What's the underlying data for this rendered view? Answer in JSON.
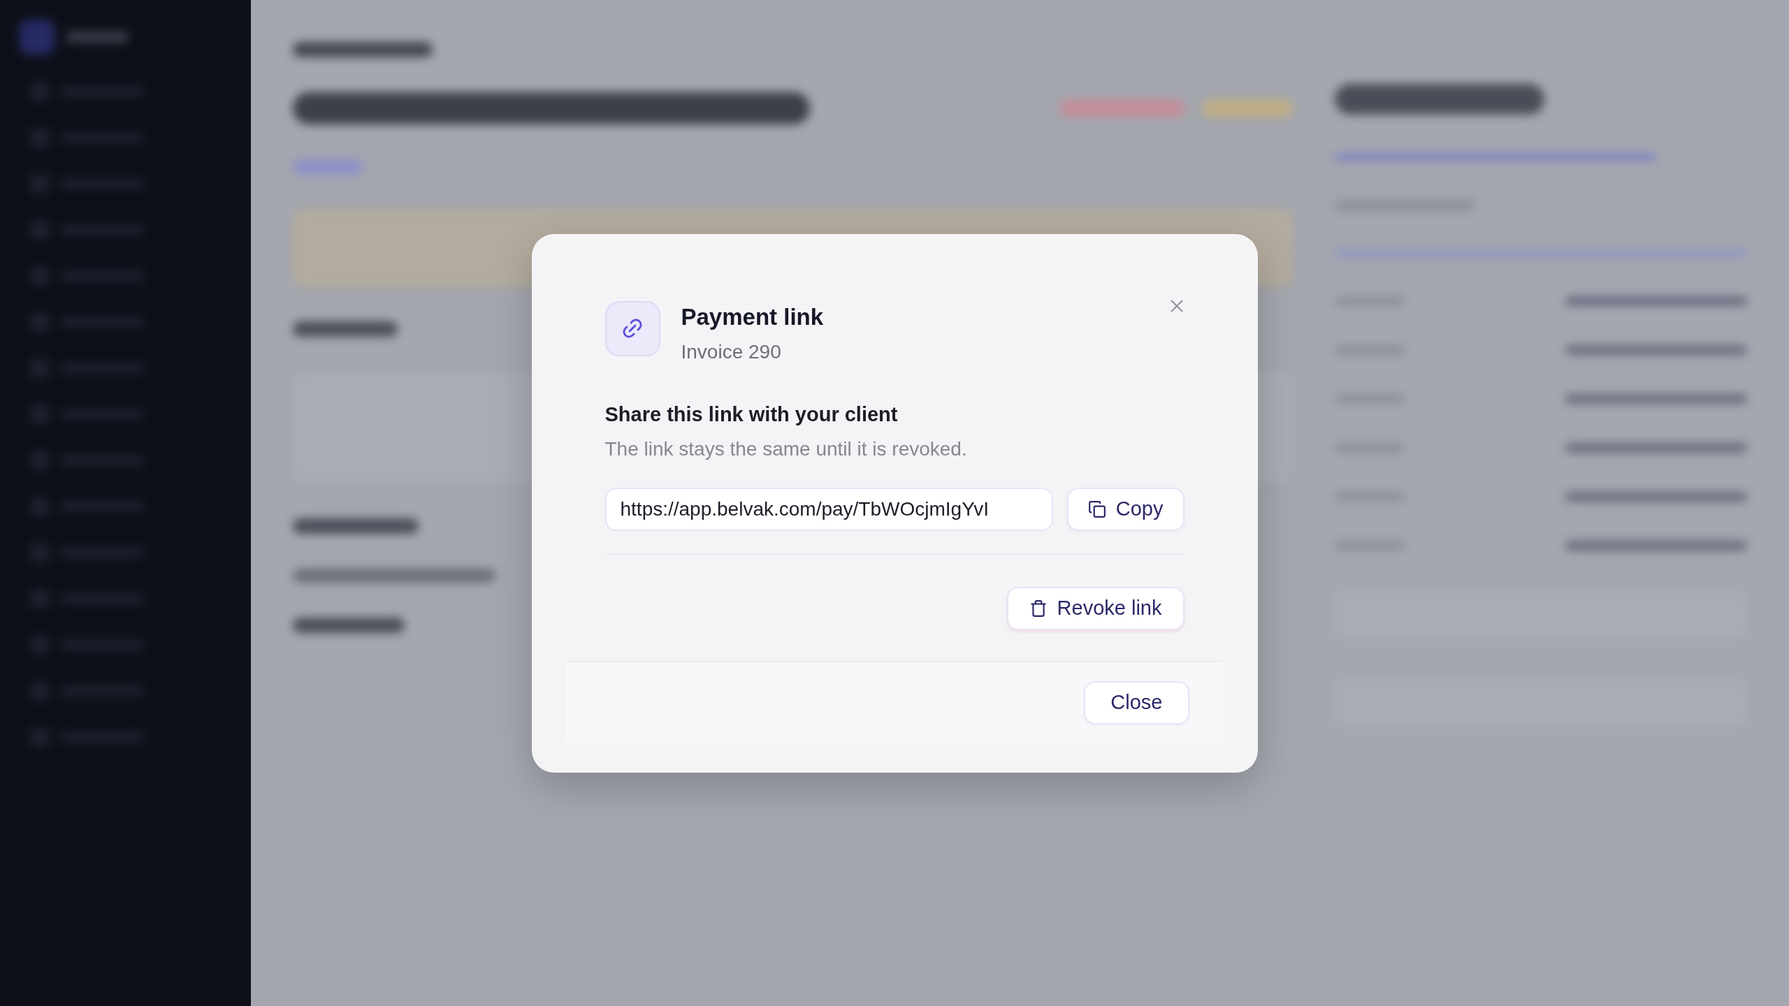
{
  "dialog": {
    "title": "Payment link",
    "subtitle": "Invoice 290",
    "section_title": "Share this link with your client",
    "section_hint": "The link stays the same until it is revoked.",
    "link_field": {
      "value": "https://app.belvak.com/pay/TbWOcjmIgYvI"
    },
    "copy_button": {
      "label": "Copy"
    },
    "revoke_button": {
      "label": "Revoke link"
    },
    "footer_buttons": [
      {
        "label": "Close"
      }
    ]
  }
}
